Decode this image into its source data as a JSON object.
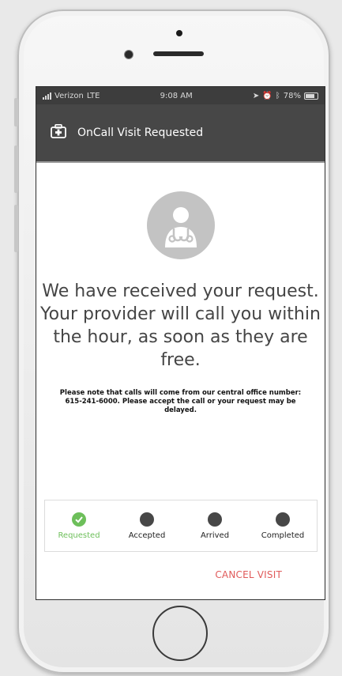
{
  "status": {
    "carrier": "Verizon",
    "network": "LTE",
    "time": "9:08 AM",
    "battery": "78%"
  },
  "appbar": {
    "title": "OnCall Visit Requested",
    "icon": "medical-kit-icon"
  },
  "main": {
    "avatar_icon": "doctor-stethoscope-icon",
    "headline": "We have received your request. Your provider will call you within the hour, as soon as they are free.",
    "note": "Please note that calls will come from our central office number: 615-241-6000. Please accept the call or your request may be delayed."
  },
  "progress": {
    "steps": [
      {
        "label": "Requested",
        "status": "done"
      },
      {
        "label": "Accepted",
        "status": "pending"
      },
      {
        "label": "Arrived",
        "status": "pending"
      },
      {
        "label": "Completed",
        "status": "pending"
      }
    ]
  },
  "actions": {
    "cancel_label": "CANCEL VISIT"
  },
  "colors": {
    "header": "#474747",
    "accent_done": "#6dbf5a",
    "cancel": "#e05a5a"
  }
}
